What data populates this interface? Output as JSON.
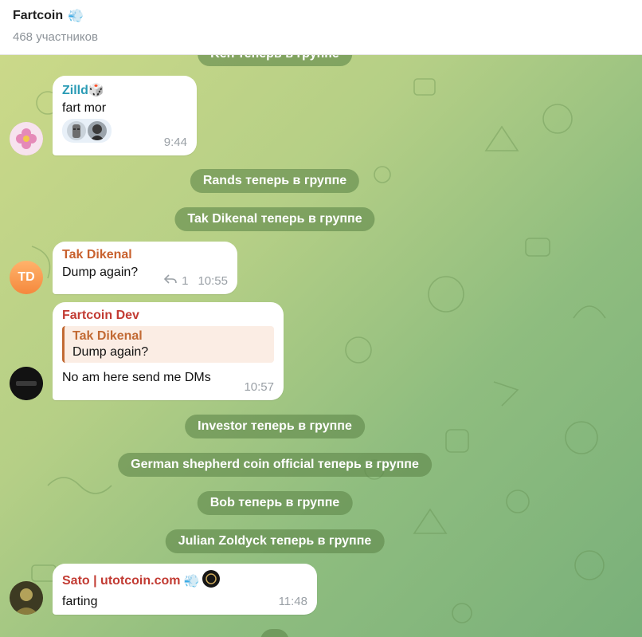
{
  "header": {
    "title": "Fartcoin",
    "title_emoji": "💨",
    "subtitle": "468 участников"
  },
  "service_messages": [
    "Rands теперь в группе",
    "Tak Dikenal теперь в группе",
    "Investor теперь в группе",
    "German shepherd coin official теперь в группе",
    "Bob теперь в группе",
    "Julian Zoldyck теперь в группе"
  ],
  "partial_service_top": "Ken теперь в группе",
  "messages": [
    {
      "sender": "Zilld",
      "sender_emoji": "🎲",
      "sender_color": "#2a9bb5",
      "text": "fart mor",
      "time": "9:44"
    },
    {
      "sender": "Tak Dikenal",
      "sender_color": "#c8612e",
      "avatar_initials": "TD",
      "text": "Dump again?",
      "reply_count": "1",
      "time": "10:55"
    },
    {
      "sender": "Fartcoin Dev",
      "sender_color": "#c23b33",
      "reply_to_name": "Tak Dikenal",
      "reply_to_text": "Dump again?",
      "text": "No am here send me DMs",
      "time": "10:57"
    },
    {
      "sender": "Sato | utotcoin.com",
      "sender_emoji": "💨",
      "sender_color": "#c23b33",
      "text": "farting",
      "time": "11:48"
    }
  ],
  "colors": {
    "service_bg": "#60874b",
    "reply_accent": "#c26a34",
    "reply_bg": "#fbede4"
  }
}
